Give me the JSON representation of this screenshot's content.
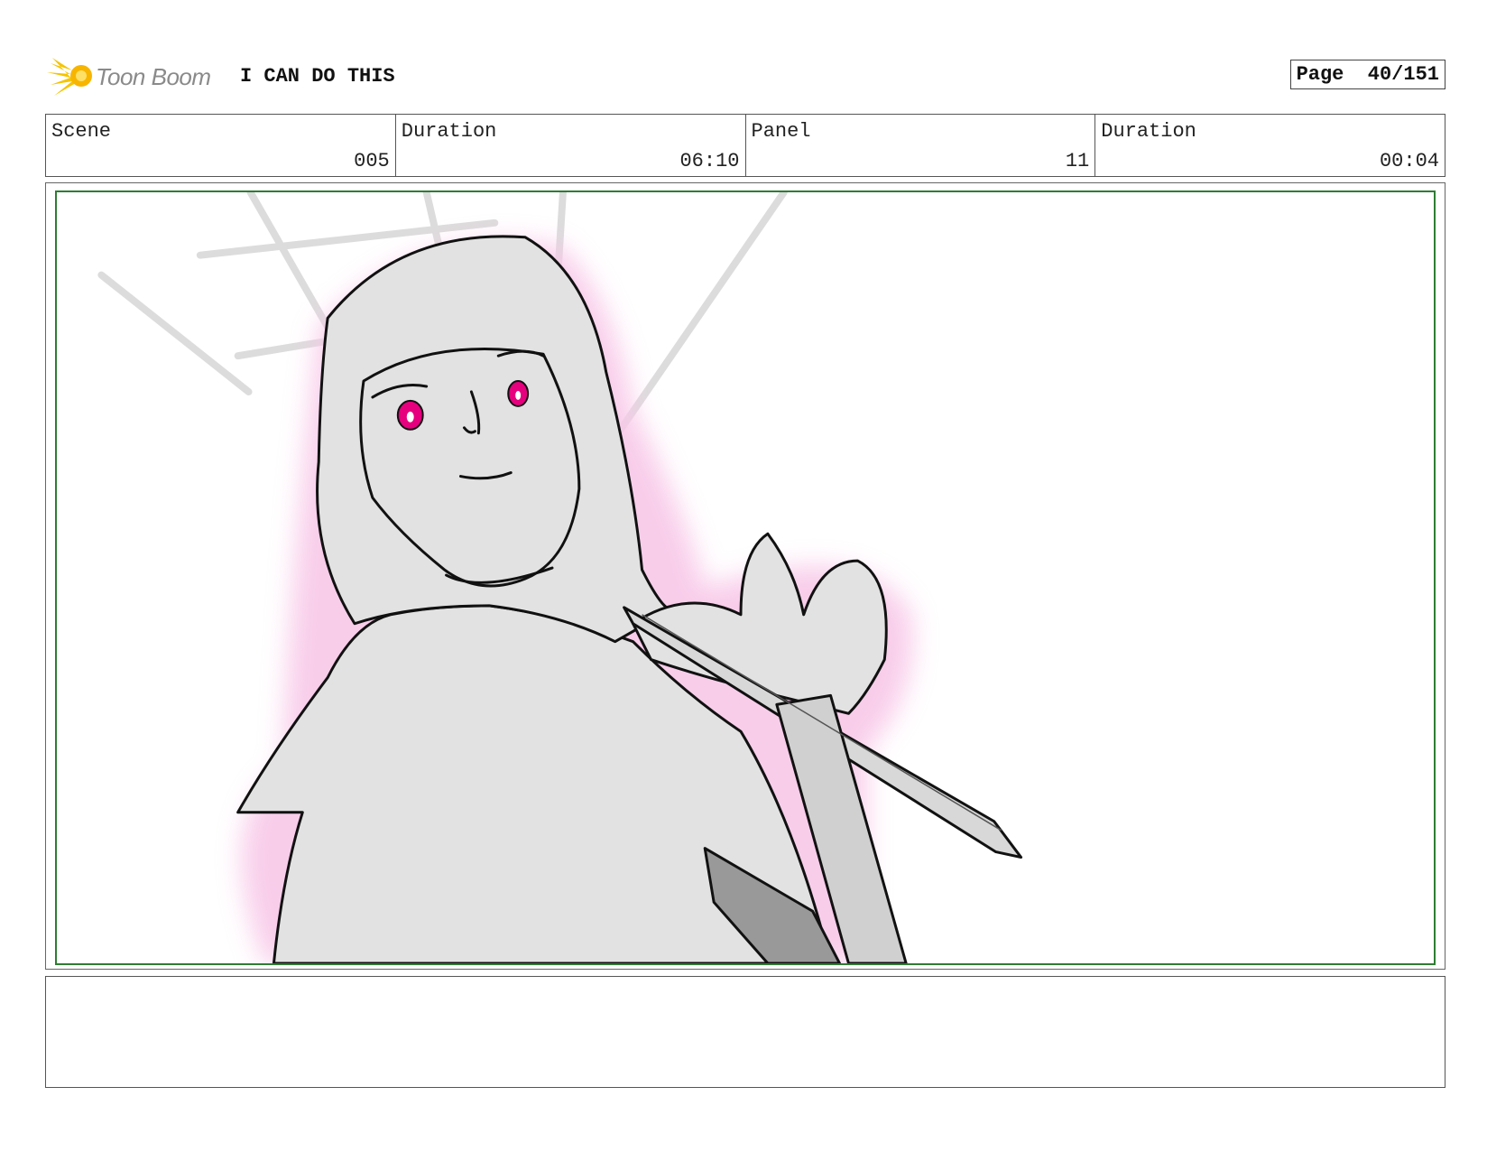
{
  "header": {
    "logo_text": "Toon Boom",
    "title": "I CAN DO THIS",
    "page_label": "Page",
    "page_value": "40/151"
  },
  "info": {
    "scene_label": "Scene",
    "scene_value": "005",
    "scene_duration_label": "Duration",
    "scene_duration_value": "06:10",
    "panel_label": "Panel",
    "panel_value": "11",
    "panel_duration_label": "Duration",
    "panel_duration_value": "00:04"
  },
  "colors": {
    "safe_area": "#2e7d32",
    "eye": "#e6007e",
    "glow": "#f8c8e8",
    "fill": "#e2e2e2"
  },
  "notes": {
    "text": ""
  }
}
